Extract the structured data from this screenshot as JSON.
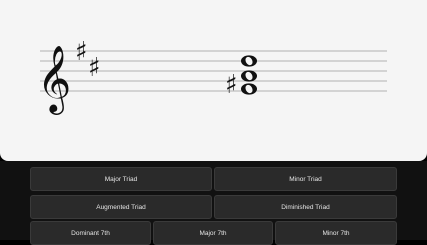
{
  "score": {
    "clef_icon": "treble-clef",
    "key_signature_icons": [
      "sharp",
      "sharp"
    ],
    "chord": {
      "accidental_icon": "sharp",
      "notes": 3
    },
    "colors": {
      "staff": "#9a9a9a",
      "ink": "#111111",
      "background": "#f5f5f5"
    }
  },
  "chord_buttons": {
    "major_triad": "Major Triad",
    "minor_triad": "Minor Triad",
    "augmented_triad": "Augmented Triad",
    "diminished_triad": "Diminished Triad",
    "dominant_7th": "Dominant 7th",
    "major_7th": "Major 7th",
    "minor_7th": "Minor 7th"
  }
}
